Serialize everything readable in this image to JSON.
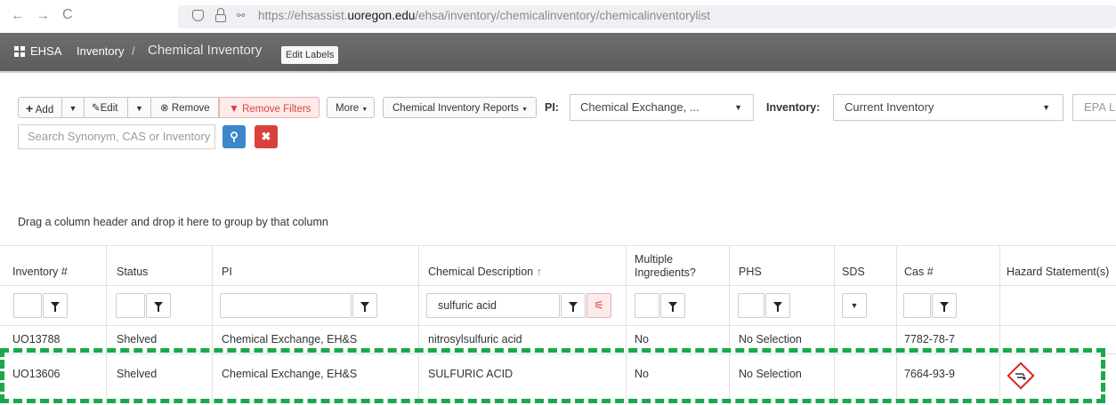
{
  "browser": {
    "back": "←",
    "forward": "→",
    "reload": "C",
    "url_prefix": "https://ehsassist.",
    "url_domain": "uoregon.edu",
    "url_path": "/ehsa/inventory/chemicalinventory/chemicalinventorylist"
  },
  "app": {
    "brand": "EHSA",
    "breadcrumb_section": "Inventory",
    "breadcrumb_sep": "/",
    "breadcrumb_page": "Chemical Inventory",
    "edit_labels": "Edit Labels"
  },
  "toolbar": {
    "add": "Add",
    "edit": "Edit",
    "remove": "Remove",
    "remove_filters": "Remove Filters",
    "more": "More",
    "reports": "Chemical Inventory Reports",
    "pi_label": "PI:",
    "pi_value": "Chemical Exchange,  ...",
    "inventory_label": "Inventory:",
    "inventory_value": "Current Inventory",
    "epa_value": "EPA L",
    "search_placeholder": "Search Synonym, CAS or Inventory"
  },
  "grid": {
    "group_hint": "Drag a column header and drop it here to group by that column",
    "columns": {
      "inventory": "Inventory #",
      "status": "Status",
      "pi": "PI",
      "description": "Chemical Description",
      "sort_arrow": "↑",
      "multiple_1": "Multiple",
      "multiple_2": "Ingredients?",
      "phs": "PHS",
      "sds": "SDS",
      "cas": "Cas #",
      "hazard": "Hazard Statement(s)"
    },
    "filter_description": "sulfuric acid",
    "rows": [
      {
        "inventory": "UO13788",
        "status": "Shelved",
        "pi": "Chemical Exchange, EH&S",
        "description": "nitrosylsulfuric acid",
        "multiple": "No",
        "phs": "No Selection",
        "sds": "",
        "cas": "7782-78-7"
      },
      {
        "inventory": "UO13606",
        "status": "Shelved",
        "pi": "Chemical Exchange, EH&S",
        "description": "SULFURIC ACID",
        "multiple": "No",
        "phs": "No Selection",
        "sds": "",
        "cas": "7664-93-9"
      }
    ]
  },
  "colors": {
    "accent_blue": "#3a87c9",
    "danger_red": "#d9413b",
    "highlight_green": "#1aa84a",
    "remove_filters_red": "#d9413b"
  },
  "icons": [
    "grid-icon",
    "plus-icon",
    "pencil-icon",
    "remove-circle-icon",
    "funnel-icon",
    "search-icon",
    "close-icon",
    "chevron-down-icon",
    "clear-filter-icon",
    "corrosive-hazard-icon",
    "shield-icon",
    "lock-icon",
    "permissions-icon"
  ]
}
